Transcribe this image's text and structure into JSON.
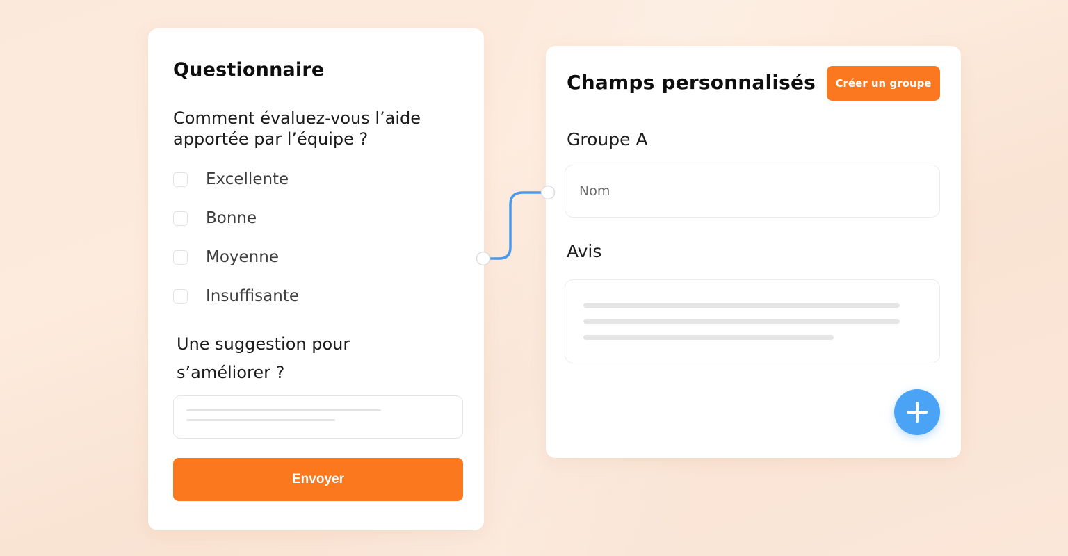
{
  "questionnaire": {
    "title": "Questionnaire",
    "question_1": "Comment évaluez-vous l’aide apportée par l’équipe ?",
    "options": [
      {
        "label": "Excellente",
        "checked": false
      },
      {
        "label": "Bonne",
        "checked": false
      },
      {
        "label": "Moyenne",
        "checked": false
      },
      {
        "label": "Insuffisante",
        "checked": false
      }
    ],
    "question_2": "Une suggestion pour s’améliorer ?",
    "submit_label": "Envoyer"
  },
  "custom_fields": {
    "title": "Champs personnalisés",
    "create_group_label": "Créer un groupe",
    "group_label": "Groupe A",
    "name_field_placeholder": "Nom",
    "review_label": "Avis",
    "add_icon": "plus-icon"
  },
  "colors": {
    "accent_orange": "#fb781f",
    "accent_blue": "#4aa3f5",
    "background": "#fbe9dc"
  }
}
